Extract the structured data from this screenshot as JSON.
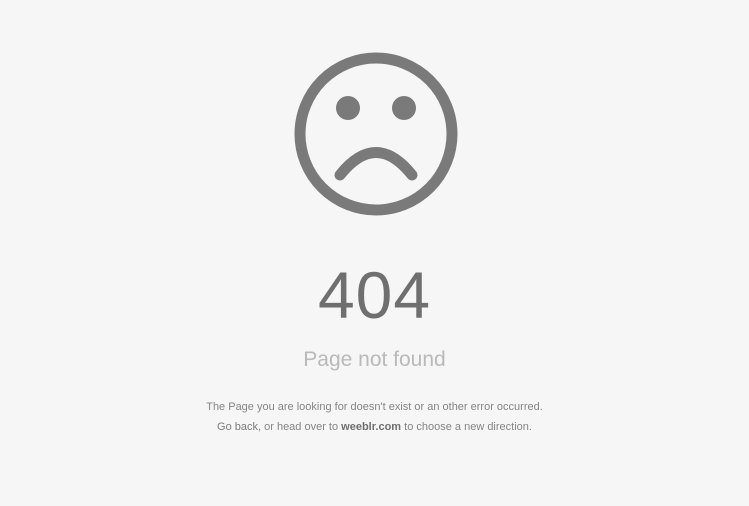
{
  "error": {
    "code": "404",
    "title": "Page not found",
    "icon": "sad-face-icon",
    "icon_color": "#7a7a7a"
  },
  "message": {
    "line1": "The Page you are looking for doesn't exist or an other error occurred.",
    "go_back_link": "Go back",
    "line2_middle": ", or head over to ",
    "site_link": "weeblr.com",
    "line2_end": " to choose a new direction."
  },
  "colors": {
    "background": "#f6f6f6",
    "code_text": "#6f6f6f",
    "title_text": "#b9b9b9",
    "body_text": "#858585"
  }
}
